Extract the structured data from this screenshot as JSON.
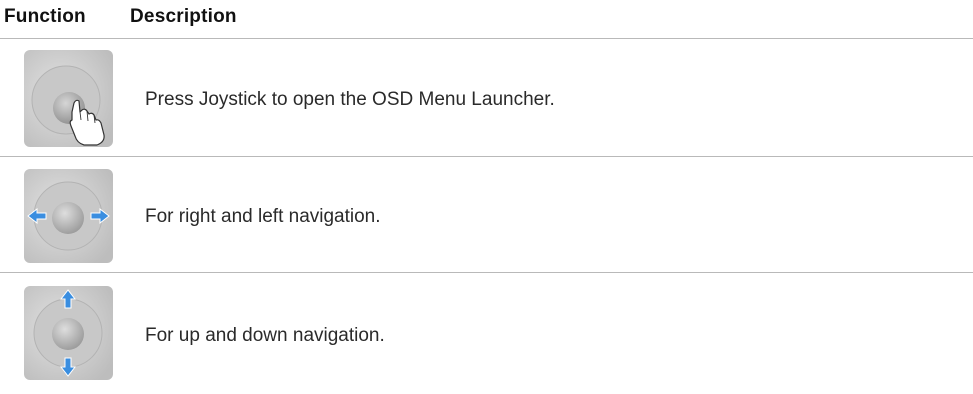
{
  "table": {
    "header": {
      "function_label": "Function",
      "description_label": "Description"
    },
    "rows": [
      {
        "icon": "joystick-press-icon",
        "description": "Press Joystick to open the OSD Menu Launcher."
      },
      {
        "icon": "joystick-left-right-icon",
        "description": "For right and left navigation."
      },
      {
        "icon": "joystick-up-down-icon",
        "description": "For up and down navigation."
      }
    ]
  },
  "colors": {
    "arrow": "#3a8ee0",
    "rule": "#b9b9b9",
    "icon_bg": "#cfcfcf"
  }
}
